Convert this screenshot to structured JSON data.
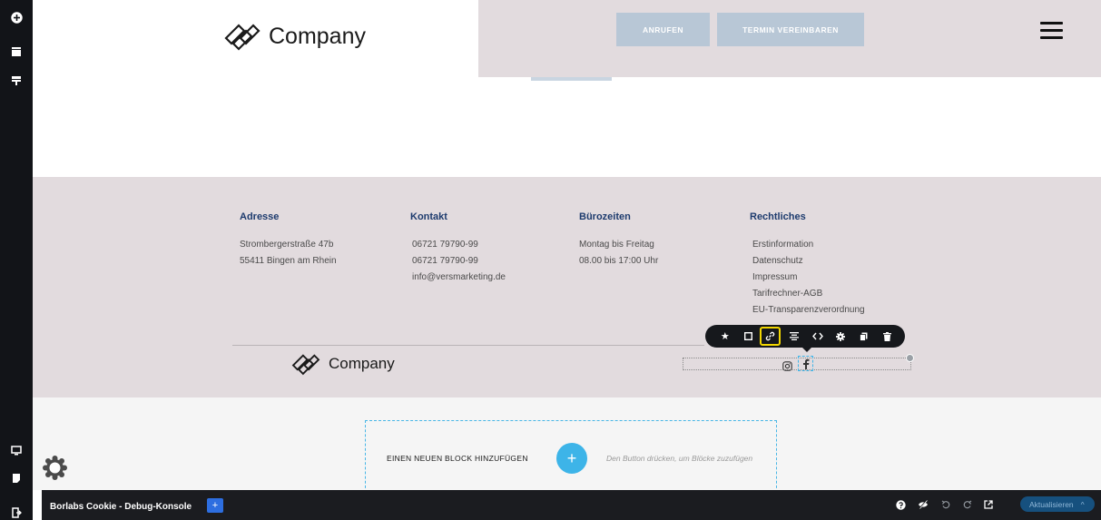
{
  "header": {
    "logo_text": "Company",
    "call_button": "ANRUFEN",
    "appointment_button": "TERMIN VEREINBAREN",
    "menu_icon": "hamburger-icon"
  },
  "footer": {
    "address": {
      "title": "Adresse",
      "lines": [
        "Strombergerstraße 47b",
        "55411 Bingen am Rhein"
      ]
    },
    "contact": {
      "title": "Kontakt",
      "lines": [
        "06721 79790-99",
        "06721 79790-99",
        "info@versmarketing.de"
      ]
    },
    "hours": {
      "title": "Bürozeiten",
      "lines": [
        "Montag bis Freitag",
        "08.00 bis 17:00 Uhr"
      ]
    },
    "legal": {
      "title": "Rechtliches",
      "lines": [
        "Erstinformation",
        "Datenschutz",
        "Impressum",
        "Tarifrechner-AGB",
        "EU-Transparenzverordnung"
      ]
    },
    "logo_text": "Company",
    "social_icons": [
      "instagram-icon",
      "facebook-icon"
    ]
  },
  "element_toolbar": {
    "icons": [
      "star-icon",
      "square-icon",
      "link-icon",
      "align-icon",
      "code-icon",
      "gear-icon",
      "copy-icon",
      "trash-icon"
    ],
    "active_icon": "link-icon",
    "active_color": "#f2d600"
  },
  "add_block": {
    "label": "EINEN NEUEN BLOCK HINZUFÜGEN",
    "plus": "+",
    "hint": "Den Button drücken, um Blöcke zuzufügen"
  },
  "left_toolbar": {
    "icons": [
      "add-icon",
      "layout-icon",
      "columns-icon",
      "desktop-icon",
      "page-icon",
      "exit-icon"
    ]
  },
  "debug_bar": {
    "title": "Borlabs Cookie - Debug-Konsole",
    "plus": "+",
    "icons": [
      "help-icon",
      "visibility-off-icon",
      "undo-icon",
      "redo-icon",
      "external-link-icon"
    ],
    "update_label": "Aktualisieren",
    "update_caret": "^"
  },
  "colors": {
    "header_bg": "#e2dbde",
    "button_bg": "#b8c7d6",
    "footer_title": "#1d3b6e",
    "accent_blue": "#3db4e8",
    "toolbar_dark": "#16181c"
  }
}
